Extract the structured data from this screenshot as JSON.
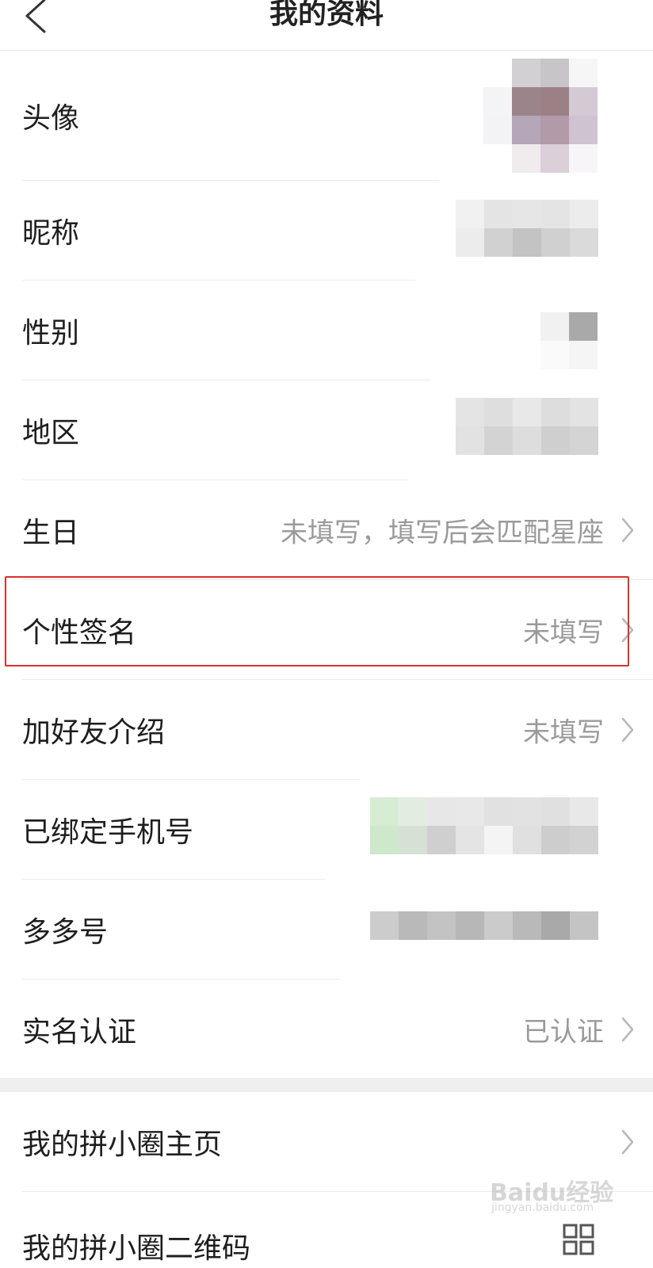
{
  "header": {
    "title": "我的资料"
  },
  "rows": [
    {
      "label": "头像",
      "value": ""
    },
    {
      "label": "昵称",
      "value": ""
    },
    {
      "label": "性别",
      "value": ""
    },
    {
      "label": "地区",
      "value": ""
    },
    {
      "label": "生日",
      "value": "未填写，填写后会匹配星座"
    },
    {
      "label": "个性签名",
      "value": "未填写"
    },
    {
      "label": "加好友介绍",
      "value": "未填写"
    },
    {
      "label": "已绑定手机号",
      "value": ""
    },
    {
      "label": "多多号",
      "value": ""
    },
    {
      "label": "实名认证",
      "value": "已认证"
    }
  ],
  "section2": [
    {
      "label": "我的拼小圈主页"
    },
    {
      "label": "我的拼小圈二维码"
    }
  ],
  "watermark": {
    "text": "Baidu经验",
    "sub": "jingyan.baidu.com"
  },
  "colors": {
    "highlight": "#d8322e",
    "label": "#1e1e1e",
    "value": "#9a9a9a"
  }
}
